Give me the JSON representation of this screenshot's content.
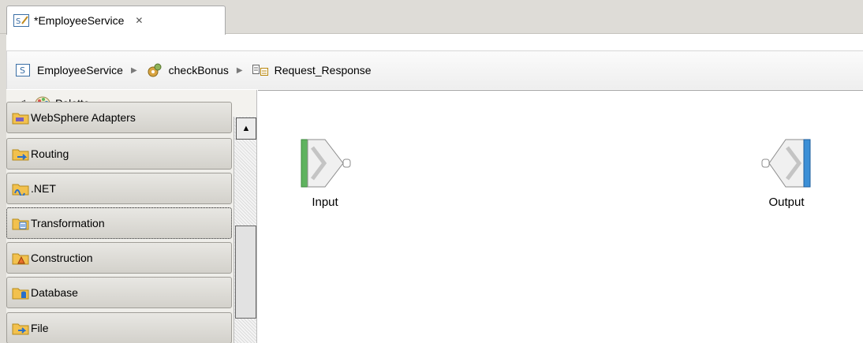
{
  "editor_tab": {
    "title": "*EmployeeService",
    "close_glyph": "✕",
    "icon": "service-file-icon"
  },
  "breadcrumb": {
    "items": [
      {
        "label": "EmployeeService",
        "icon": "service-icon"
      },
      {
        "label": "checkBonus",
        "icon": "operation-icon"
      },
      {
        "label": "Request_Response",
        "icon": "flow-icon"
      }
    ],
    "separator": "▶"
  },
  "palette": {
    "collapse_glyph": "◁",
    "label": "Palette",
    "drawers": [
      {
        "label": "WebSphere Adapters",
        "icon": "adapter-folder-icon"
      },
      {
        "label": "Routing",
        "icon": "routing-folder-icon"
      },
      {
        "label": ".NET",
        "icon": "dotnet-folder-icon"
      },
      {
        "label": "Transformation",
        "icon": "transformation-folder-icon"
      },
      {
        "label": "Construction",
        "icon": "construction-folder-icon"
      },
      {
        "label": "Database",
        "icon": "database-folder-icon"
      },
      {
        "label": "File",
        "icon": "file-folder-icon"
      }
    ],
    "scroll_up_glyph": "▲"
  },
  "canvas": {
    "nodes": [
      {
        "label": "Input",
        "icon": "input-node-icon"
      },
      {
        "label": "Output",
        "icon": "output-node-icon"
      }
    ]
  },
  "colors": {
    "input_bar": "#5fb35f",
    "output_bar": "#3b8fd6",
    "folder": "#f2c14e"
  }
}
